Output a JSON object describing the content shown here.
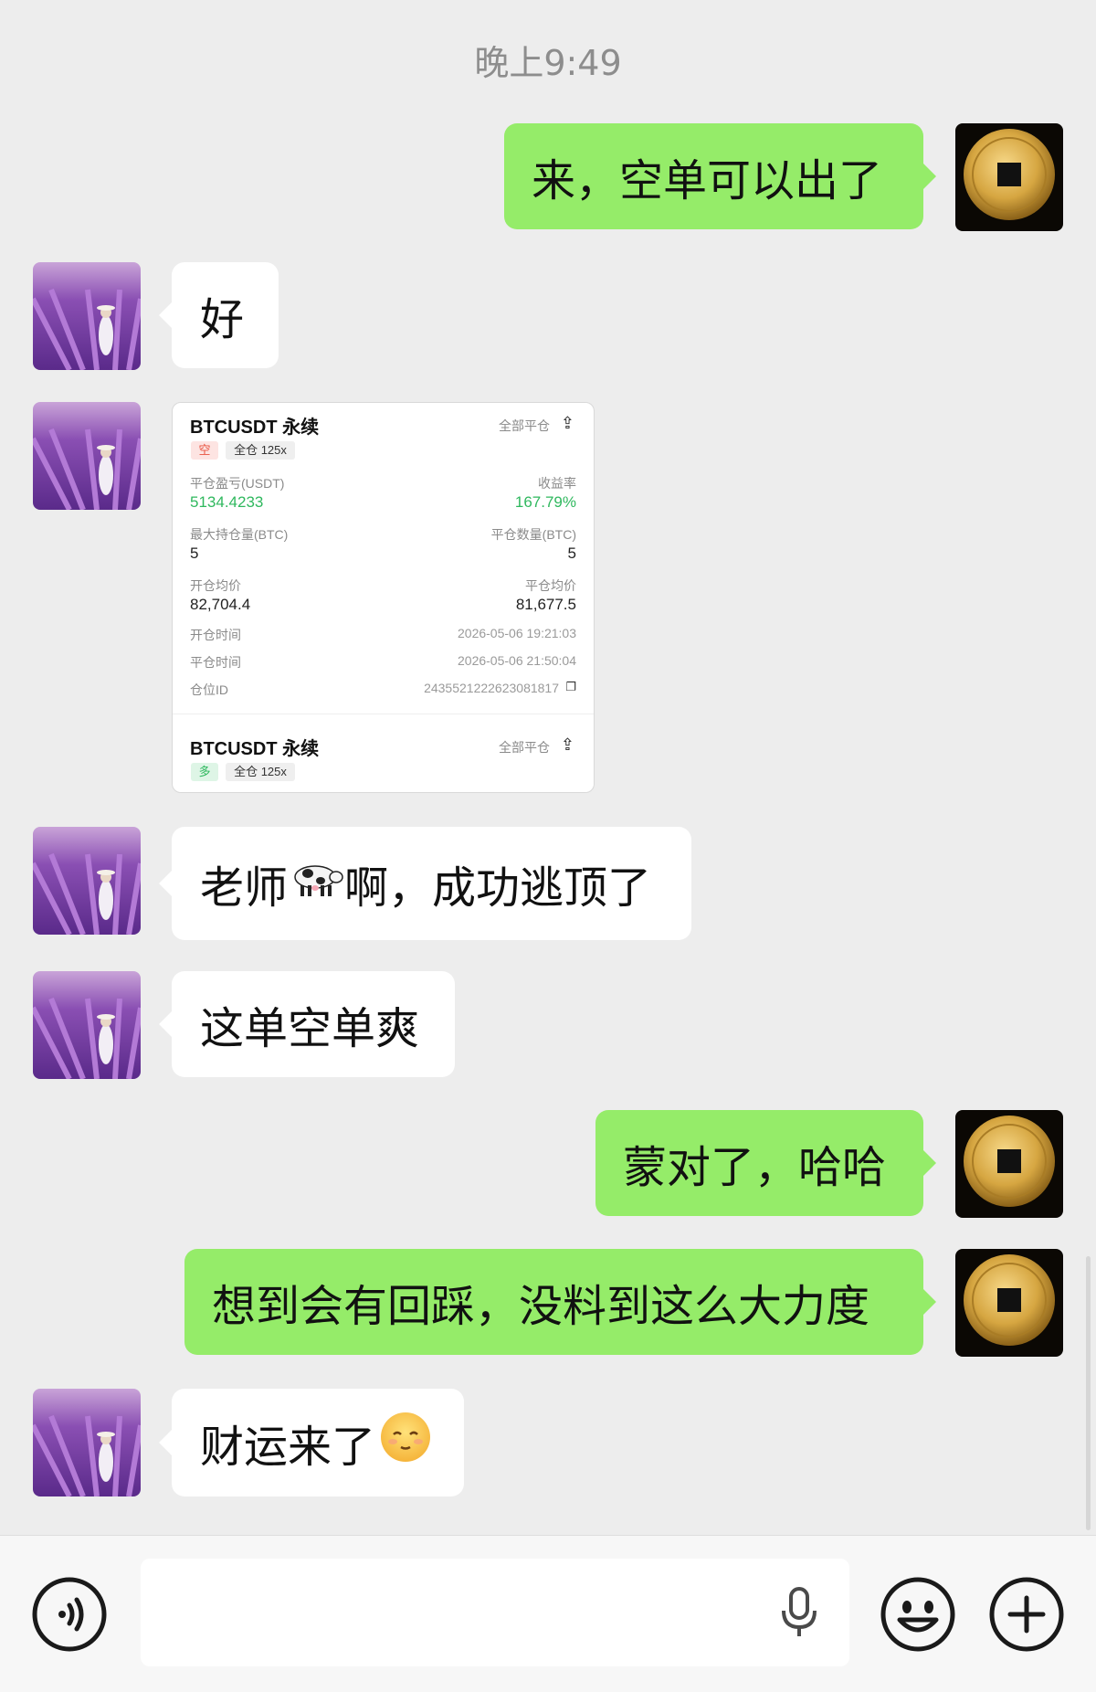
{
  "header": {
    "timestamp": "晚上9:49"
  },
  "messages": [
    {
      "side": "right",
      "text": "来，空单可以出了"
    },
    {
      "side": "left",
      "text": "好"
    },
    {
      "side": "left",
      "type": "image-card"
    },
    {
      "side": "left",
      "text_before": "老师",
      "emoji": "cow-emoji",
      "text_after": "啊，成功逃顶了"
    },
    {
      "side": "left",
      "text": "这单空单爽"
    },
    {
      "side": "right",
      "text": "蒙对了，哈哈"
    },
    {
      "side": "right",
      "text": "想到会有回踩，没料到这么大力度"
    },
    {
      "side": "left",
      "text": "财运来了",
      "emoji": "relieved-face-emoji"
    }
  ],
  "card": {
    "pair": "BTCUSDT 永续",
    "close_all": "全部平仓",
    "side_tag": "空",
    "margin_tag": "全仓 125x",
    "pnl_label": "平仓盈亏(USDT)",
    "pnl_value": "5134.4233",
    "roi_label": "收益率",
    "roi_value": "167.79%",
    "max_hold_label": "最大持仓量(BTC)",
    "max_hold_value": "5",
    "close_qty_label": "平仓数量(BTC)",
    "close_qty_value": "5",
    "open_avg_label": "开仓均价",
    "open_avg_value": "82,704.4",
    "close_avg_label": "平仓均价",
    "close_avg_value": "81,677.5",
    "open_time_label": "开仓时间",
    "open_time_value": "2026-05-06 19:21:03",
    "close_time_label": "平仓时间",
    "close_time_value": "2026-05-06 21:50:04",
    "position_id_label": "仓位ID",
    "position_id_value": "2435521222623081817",
    "pair2": "BTCUSDT 永续",
    "close_all2": "全部平仓",
    "side_tag2": "多",
    "margin_tag2": "全仓 125x"
  },
  "colors": {
    "background": "#ededed",
    "bubble_right": "#95ec69",
    "bubble_left": "#ffffff",
    "profit_green": "#2fb85e",
    "short_red": "#e8523f"
  },
  "bottom_bar": {
    "voice_icon": "voice-icon",
    "mic_icon": "microphone-icon",
    "emoji_icon": "emoji-icon",
    "plus_icon": "plus-icon"
  }
}
